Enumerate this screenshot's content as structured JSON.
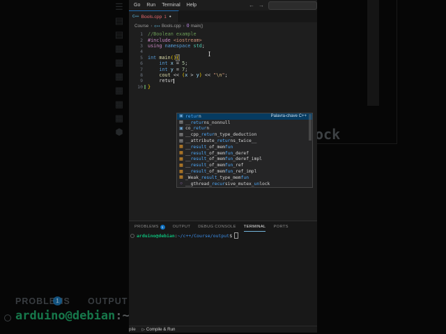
{
  "background": {
    "ghost_icons": [
      "hamburger",
      "box",
      "box",
      "grid",
      "grid",
      "grid",
      "grid",
      "grid",
      "grid",
      "cube"
    ],
    "ghost_panel_tab_problems": "PROBLEMS",
    "ghost_badge_count": "1",
    "ghost_panel_tab_output": "OUTPUT",
    "ghost_prompt_user": "arduino@debian",
    "ghost_prompt_rest": ":~/c+",
    "ghost_right_fragment": "ock"
  },
  "menu_bar": {
    "items": [
      "Go",
      "Run",
      "Terminal",
      "Help"
    ],
    "back_arrow": "←",
    "forward_arrow": "→"
  },
  "tab_bar": {
    "file_icon": "C++",
    "file_name": "Bools.cpp",
    "problem_count": "1",
    "modified_dot": "●"
  },
  "breadcrumb": {
    "folder": "Course",
    "file_icon": "C++",
    "file": "Bools.cpp",
    "symbol_icon": "{}",
    "symbol": "main()",
    "separator": "›"
  },
  "editor": {
    "lines": [
      {
        "n": "1",
        "t": [
          [
            "//Boolean example",
            "comment"
          ]
        ]
      },
      {
        "n": "2",
        "t": [
          [
            "#include",
            "macro"
          ],
          [
            " ",
            "plain"
          ],
          [
            "<iostream>",
            "string"
          ]
        ]
      },
      {
        "n": "3",
        "t": [
          [
            "using",
            "macro"
          ],
          [
            " ",
            "plain"
          ],
          [
            "namespace",
            "kw"
          ],
          [
            " ",
            "plain"
          ],
          [
            "std",
            "type"
          ],
          [
            ";",
            "plain"
          ]
        ]
      },
      {
        "n": "4",
        "t": []
      },
      {
        "n": "5",
        "t": [
          [
            "int",
            "kw"
          ],
          [
            " ",
            "plain"
          ],
          [
            "main",
            "fn"
          ],
          [
            "()",
            "bracket"
          ],
          [
            "{",
            "bracketbox"
          ]
        ]
      },
      {
        "n": "6",
        "t": [
          [
            "    ",
            "plain"
          ],
          [
            "int",
            "kw"
          ],
          [
            " ",
            "plain"
          ],
          [
            "x",
            "var"
          ],
          [
            " = ",
            "plain"
          ],
          [
            "5",
            "num"
          ],
          [
            ";",
            "plain"
          ]
        ]
      },
      {
        "n": "7",
        "t": [
          [
            "    ",
            "plain"
          ],
          [
            "int",
            "kw"
          ],
          [
            " ",
            "plain"
          ],
          [
            "y",
            "var"
          ],
          [
            " = ",
            "plain"
          ],
          [
            "7",
            "num"
          ],
          [
            ";",
            "plain"
          ]
        ]
      },
      {
        "n": "8",
        "t": [
          [
            "    ",
            "plain"
          ],
          [
            "cout",
            "fn"
          ],
          [
            " << ",
            "plain"
          ],
          [
            "(",
            "bracket"
          ],
          [
            "x",
            "var"
          ],
          [
            " > ",
            "plain"
          ],
          [
            "y",
            "var"
          ],
          [
            ")",
            "bracket"
          ],
          [
            " << ",
            "plain"
          ],
          [
            "\"",
            "string"
          ],
          [
            "\\n",
            "escape"
          ],
          [
            "\"",
            "string"
          ],
          [
            ";",
            "plain"
          ]
        ]
      },
      {
        "n": "9",
        "t": [
          [
            "    retur",
            "plain"
          ]
        ],
        "cursor": true
      },
      {
        "n": "10",
        "t": [
          [
            "}",
            "bracket"
          ]
        ],
        "changebar": true
      }
    ]
  },
  "suggest": {
    "selected_detail": "Palavra-chave C++",
    "items": [
      {
        "icon": "keyword",
        "selected": true,
        "detail": "Palavra-chave C++",
        "segs": [
          [
            "retur",
            1
          ],
          [
            "n",
            0
          ]
        ]
      },
      {
        "icon": "field",
        "segs": [
          [
            "__",
            0
          ],
          [
            "retur",
            1
          ],
          [
            "ns_nonnull",
            0
          ]
        ]
      },
      {
        "icon": "keyword",
        "segs": [
          [
            "co_",
            0
          ],
          [
            "retur",
            1
          ],
          [
            "n",
            0
          ]
        ]
      },
      {
        "icon": "field",
        "segs": [
          [
            "__cpp_",
            0
          ],
          [
            "retur",
            1
          ],
          [
            "n_type_deduction",
            0
          ]
        ]
      },
      {
        "icon": "field",
        "segs": [
          [
            "__attribute_",
            0
          ],
          [
            "retur",
            1
          ],
          [
            "ns_twice__",
            0
          ]
        ]
      },
      {
        "icon": "struct",
        "segs": [
          [
            "__",
            0
          ],
          [
            "result",
            1
          ],
          [
            "_of_mem",
            0
          ],
          [
            "fun",
            1
          ]
        ]
      },
      {
        "icon": "struct",
        "segs": [
          [
            "__",
            0
          ],
          [
            "result",
            1
          ],
          [
            "_of_mem",
            0
          ],
          [
            "fun",
            1
          ],
          [
            "_deref",
            0
          ]
        ]
      },
      {
        "icon": "struct",
        "segs": [
          [
            "__",
            0
          ],
          [
            "result",
            1
          ],
          [
            "_of_mem",
            0
          ],
          [
            "fun",
            1
          ],
          [
            "_deref_impl",
            0
          ]
        ]
      },
      {
        "icon": "struct",
        "segs": [
          [
            "__",
            0
          ],
          [
            "result",
            1
          ],
          [
            "_of_mem",
            0
          ],
          [
            "fun",
            1
          ],
          [
            "_ref",
            0
          ]
        ]
      },
      {
        "icon": "struct",
        "segs": [
          [
            "__",
            0
          ],
          [
            "result",
            1
          ],
          [
            "_of_mem",
            0
          ],
          [
            "fun",
            1
          ],
          [
            "_ref_impl",
            0
          ]
        ]
      },
      {
        "icon": "struct",
        "segs": [
          [
            "_Weak_",
            0
          ],
          [
            "result",
            1
          ],
          [
            "_type_mem",
            0
          ],
          [
            "fun",
            1
          ]
        ]
      },
      {
        "icon": "method",
        "segs": [
          [
            "__gthread_",
            0
          ],
          [
            "recur",
            1
          ],
          [
            "sive_mutex_",
            0
          ],
          [
            "un",
            1
          ],
          [
            "lock",
            0
          ]
        ]
      }
    ]
  },
  "panel": {
    "tabs": [
      {
        "label": "PROBLEMS",
        "badge": "1"
      },
      {
        "label": "OUTPUT"
      },
      {
        "label": "DEBUG CONSOLE"
      },
      {
        "label": "TERMINAL",
        "active": true
      },
      {
        "label": "PORTS"
      }
    ]
  },
  "terminal": {
    "user": "arduino@debian",
    "colon": ":",
    "path": "~/c++/Course/output",
    "prompt_symbol": "$"
  },
  "status_bar": {
    "left_partial": "pile",
    "run_icon": "▷",
    "run_label": "Compile & Run"
  },
  "colors": {
    "accent_blue": "#0078d4",
    "tab_error_red": "#e4676b",
    "match_blue": "#4daafc",
    "selected_row_bg": "#063b61",
    "terminal_green": "#0dbc79",
    "terminal_path_blue": "#3b8eea",
    "badge_blue": "#0e70c0"
  }
}
